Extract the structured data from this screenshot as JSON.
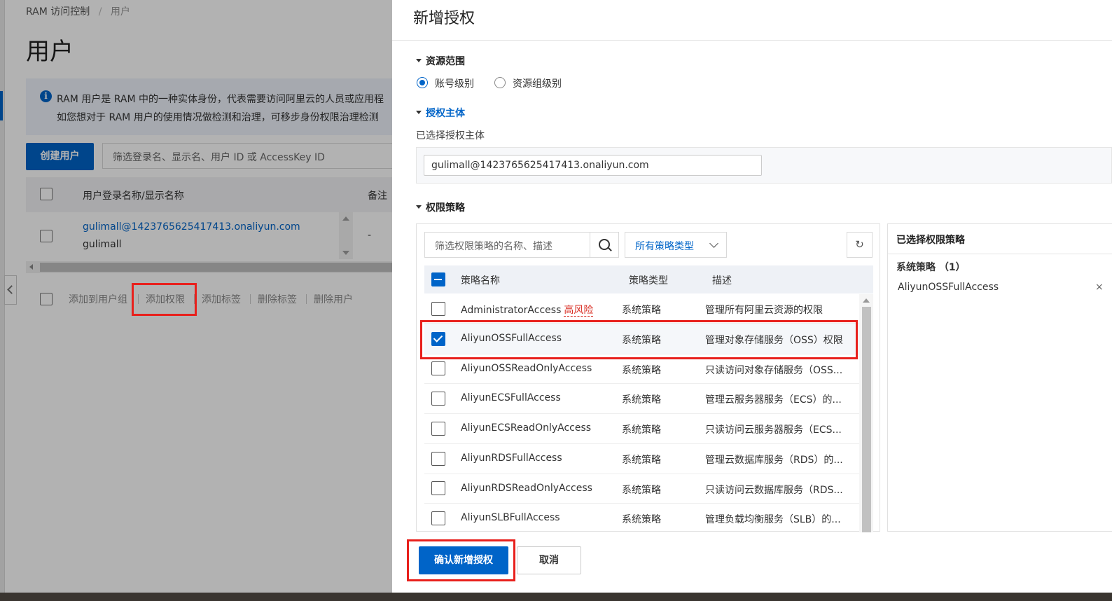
{
  "background": {
    "breadcrumb": [
      "RAM 访问控制",
      "/",
      "用户"
    ],
    "page_title": "用户",
    "info_line1": "RAM 用户是 RAM 中的一种实体身份，代表需要访问阿里云的人员或应用程",
    "info_line2": "如您想对于 RAM 用户的使用情况做检测和治理，可移步身份权限治理检测",
    "create_user": "创建用户",
    "search_placeholder": "筛选登录名、显示名、用户 ID 或 AccessKey ID",
    "col_name": "用户登录名称/显示名称",
    "col_note": "备注",
    "user_login": "gulimall@1423765625417413.onaliyun.com",
    "user_display": "gulimall",
    "user_note": "-",
    "actions": [
      "添加到用户组",
      "添加权限",
      "添加标签",
      "删除标签",
      "删除用户"
    ]
  },
  "drawer": {
    "title": "新增授权",
    "scope_section": "资源范围",
    "scope_options": [
      "账号级别",
      "资源组级别"
    ],
    "principal_section": "授权主体",
    "principal_label": "已选择授权主体",
    "principal_value": "gulimall@1423765625417413.onaliyun.com",
    "policy_section": "权限策略",
    "policy_search_placeholder": "筛选权限策略的名称、描述",
    "policy_type_select": "所有策略类型",
    "col_name": "策略名称",
    "col_type": "策略类型",
    "col_desc": "描述",
    "high_risk": "高风险",
    "policies": [
      {
        "name": "AdministratorAccess",
        "type": "系统策略",
        "desc": "管理所有阿里云资源的权限"
      },
      {
        "name": "AliyunOSSFullAccess",
        "type": "系统策略",
        "desc": "管理对象存储服务（OSS）权限"
      },
      {
        "name": "AliyunOSSReadOnlyAccess",
        "type": "系统策略",
        "desc": "只读访问对象存储服务（OSS..."
      },
      {
        "name": "AliyunECSFullAccess",
        "type": "系统策略",
        "desc": "管理云服务器服务（ECS）的..."
      },
      {
        "name": "AliyunECSReadOnlyAccess",
        "type": "系统策略",
        "desc": "只读访问云服务器服务（ECS..."
      },
      {
        "name": "AliyunRDSFullAccess",
        "type": "系统策略",
        "desc": "管理云数据库服务（RDS）的..."
      },
      {
        "name": "AliyunRDSReadOnlyAccess",
        "type": "系统策略",
        "desc": "只读访问云数据库服务（RDS..."
      },
      {
        "name": "AliyunSLBFullAccess",
        "type": "系统策略",
        "desc": "管理负载均衡服务（SLB）的..."
      }
    ],
    "selected_title": "已选择权限策略",
    "selected_group": "系统策略 （1）",
    "selected_item": "AliyunOSSFullAccess",
    "selected_remove": "×",
    "confirm": "确认新增授权",
    "cancel": "取消"
  },
  "colors": {
    "primary": "#0064c8",
    "highlight": "#e8201c",
    "risk": "#d93026"
  },
  "icons": [
    "info-icon",
    "search-icon",
    "chevron-down-icon",
    "refresh-icon",
    "close-icon",
    "collapse-left-icon"
  ]
}
